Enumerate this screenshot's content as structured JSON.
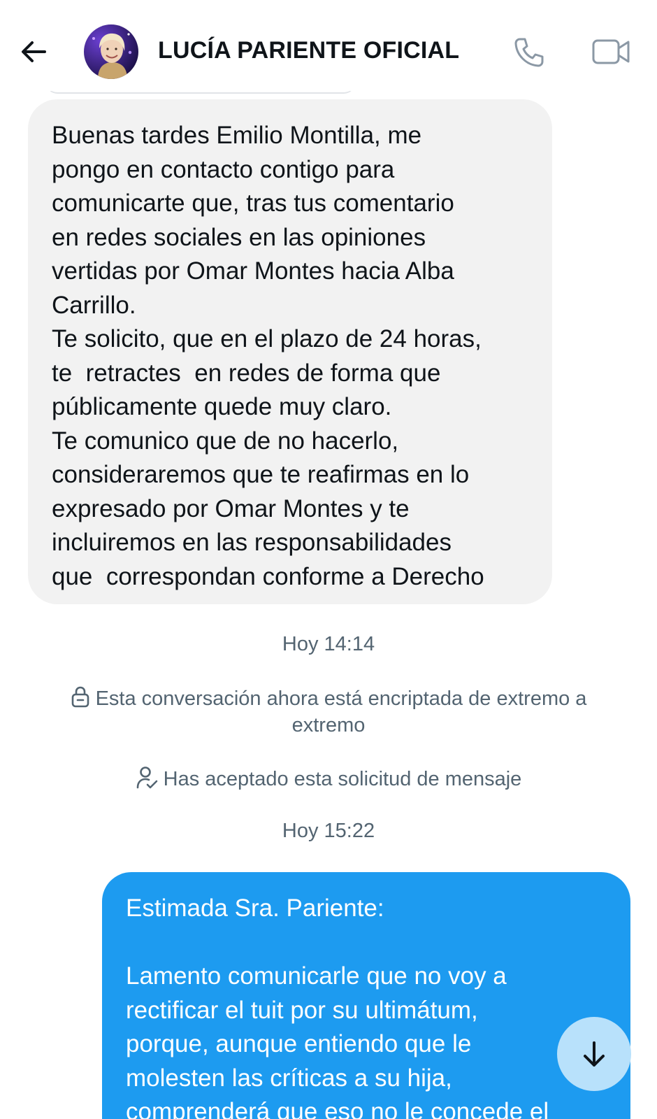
{
  "header": {
    "contact_name": "LUCÍA PARIENTE OFICIAL",
    "icons": {
      "back": "arrow-left-icon",
      "call": "phone-icon",
      "video": "video-camera-icon"
    }
  },
  "messages": {
    "incoming": {
      "text": "Buenas tardes Emilio Montilla, me\npongo en contacto contigo para\ncomunicarte que, tras tus comentario\nen redes sociales en las opiniones\nvertidas por Omar Montes hacia Alba\nCarrillo.\nTe solicito, que en el plazo de 24 horas,\nte  retractes  en redes de forma que\npúblicamente quede muy claro.\nTe comunico que de no hacerlo,\nconsideraremos que te reafirmas en lo\nexpresado por Omar Montes y te\nincluiremos en las responsabilidades\nque  correspondan conforme a Derecho"
    },
    "timestamp_1": "Hoy 14:14",
    "encryption_notice": "Esta conversación ahora está encriptada de extremo a extremo",
    "accepted_notice": "Has aceptado esta solicitud de mensaje",
    "timestamp_2": "Hoy 15:22",
    "outgoing": {
      "text": "Estimada Sra. Pariente:\n\nLamento comunicarle que no voy a\nrectificar el tuit por su ultimátum,\nporque, aunque entiendo que le\nmolesten las críticas a su hija,\ncomprenderá que eso no le concede el"
    }
  },
  "colors": {
    "incoming_bubble": "#f2f2f2",
    "outgoing_bubble": "#1d9bf0",
    "meta_text": "#536471",
    "scroll_button": "#b8e1fb"
  }
}
